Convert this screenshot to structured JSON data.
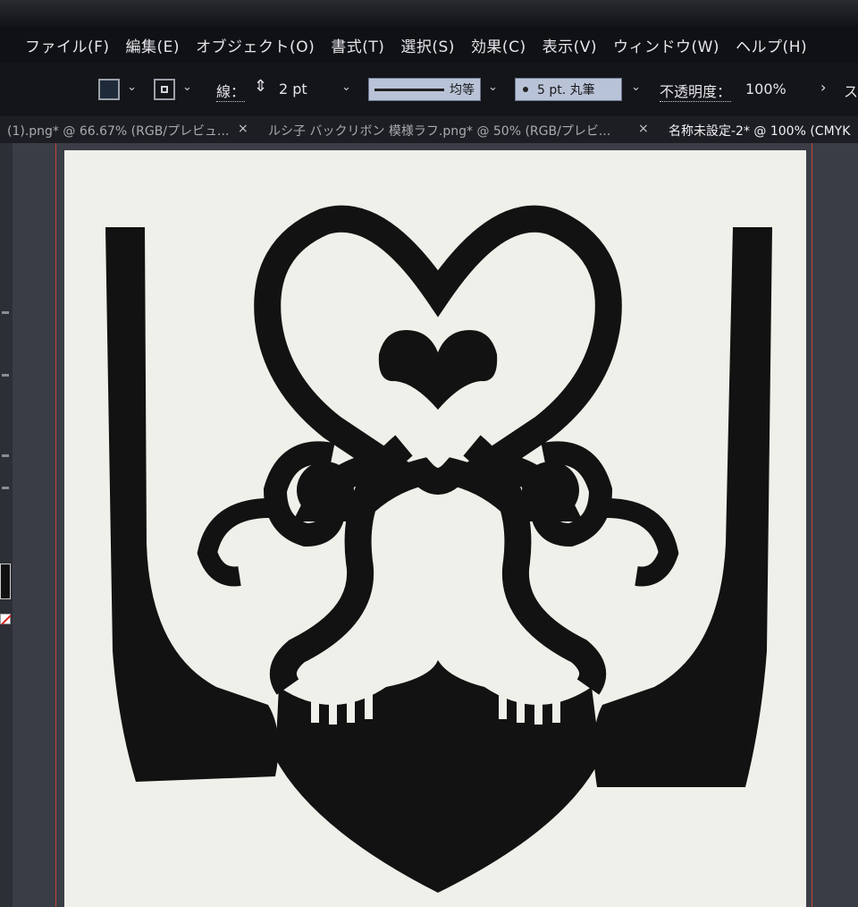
{
  "menu": {
    "items": [
      "ファイル(F)",
      "編集(E)",
      "オブジェクト(O)",
      "書式(T)",
      "選択(S)",
      "効果(C)",
      "表示(V)",
      "ウィンドウ(W)",
      "ヘルプ(H)"
    ]
  },
  "control_bar": {
    "stroke_label": "線：",
    "stroke_weight": "2 pt",
    "profile_label": "均等",
    "brush_label": "5 pt. 丸筆",
    "opacity_label": "不透明度：",
    "opacity_value": "100%",
    "more_glyph": "ス"
  },
  "tabs": {
    "items": [
      {
        "label": "(1).png* @ 66.67% (RGB/プレビュ...",
        "active": false
      },
      {
        "label": "ルシ子 バックリボン 模様ラフ.png* @ 50% (RGB/プレビ...",
        "active": false
      },
      {
        "label": "名称未設定-2* @ 100% (CMYK",
        "active": true
      }
    ],
    "close_glyph": "×"
  },
  "colors": {
    "menu_bg": "#101114",
    "workspace_bg": "#3a3d46",
    "artboard_bg": "#eef0e9",
    "artwork_fill": "#121212",
    "guide_red": "#e0483a"
  },
  "icons": {
    "fill_swatch": "fill-swatch-icon",
    "stroke_swatch": "stroke-swatch-icon",
    "stepper": "up-down-stepper-icon",
    "dropdown": "chevron-down-icon",
    "close": "close-icon"
  }
}
